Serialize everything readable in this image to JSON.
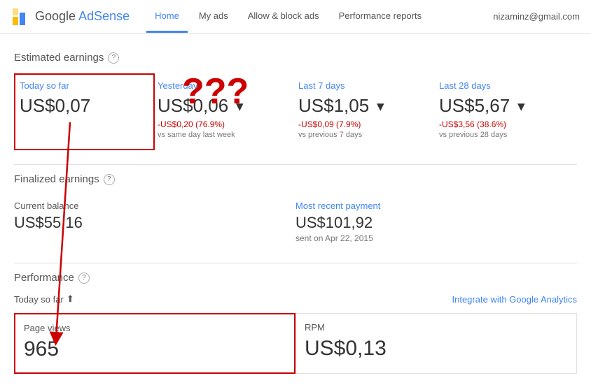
{
  "header": {
    "logo_google": "Google",
    "logo_adsense": "AdSense",
    "nav": [
      {
        "id": "home",
        "label": "Home",
        "active": true
      },
      {
        "id": "my-ads",
        "label": "My ads",
        "active": false
      },
      {
        "id": "allow-block-ads",
        "label": "Allow & block ads",
        "active": false
      },
      {
        "id": "performance-reports",
        "label": "Performance reports",
        "active": false
      }
    ],
    "user_email": "nizaminz@gmail.com"
  },
  "estimated_earnings": {
    "section_title": "Estimated earnings",
    "cards": [
      {
        "period": "Today so far",
        "amount": "US$0,07",
        "change": null,
        "vs": null,
        "highlighted": true
      },
      {
        "period": "Yesterday",
        "amount": "US$0,06",
        "change": "-US$0,20 (76.9%)",
        "vs": "vs same day last week",
        "highlighted": false
      },
      {
        "period": "Last 7 days",
        "amount": "US$1,05",
        "change": "-US$0,09 (7.9%)",
        "vs": "vs previous 7 days",
        "highlighted": false
      },
      {
        "period": "Last 28 days",
        "amount": "US$5,67",
        "change": "-US$3,56 (38.6%)",
        "vs": "vs previous 28 days",
        "highlighted": false
      }
    ]
  },
  "finalized_earnings": {
    "section_title": "Finalized earnings",
    "current_balance_label": "Current balance",
    "current_balance_amount": "US$55,16",
    "most_recent_payment_label": "Most recent payment",
    "most_recent_payment_amount": "US$101,92",
    "most_recent_payment_date": "sent on Apr 22, 2015"
  },
  "performance": {
    "section_title": "Performance",
    "period_label": "Today so far",
    "integrate_link": "Integrate with Google Analytics",
    "stats": [
      {
        "label": "Page views",
        "value": "965",
        "highlighted": true
      },
      {
        "label": "RPM",
        "value": "US$0,13",
        "highlighted": false
      }
    ]
  },
  "annotation": {
    "question_marks": "???"
  },
  "icons": {
    "arrow_down": "▼",
    "chevron_down": "▾",
    "help": "?"
  }
}
